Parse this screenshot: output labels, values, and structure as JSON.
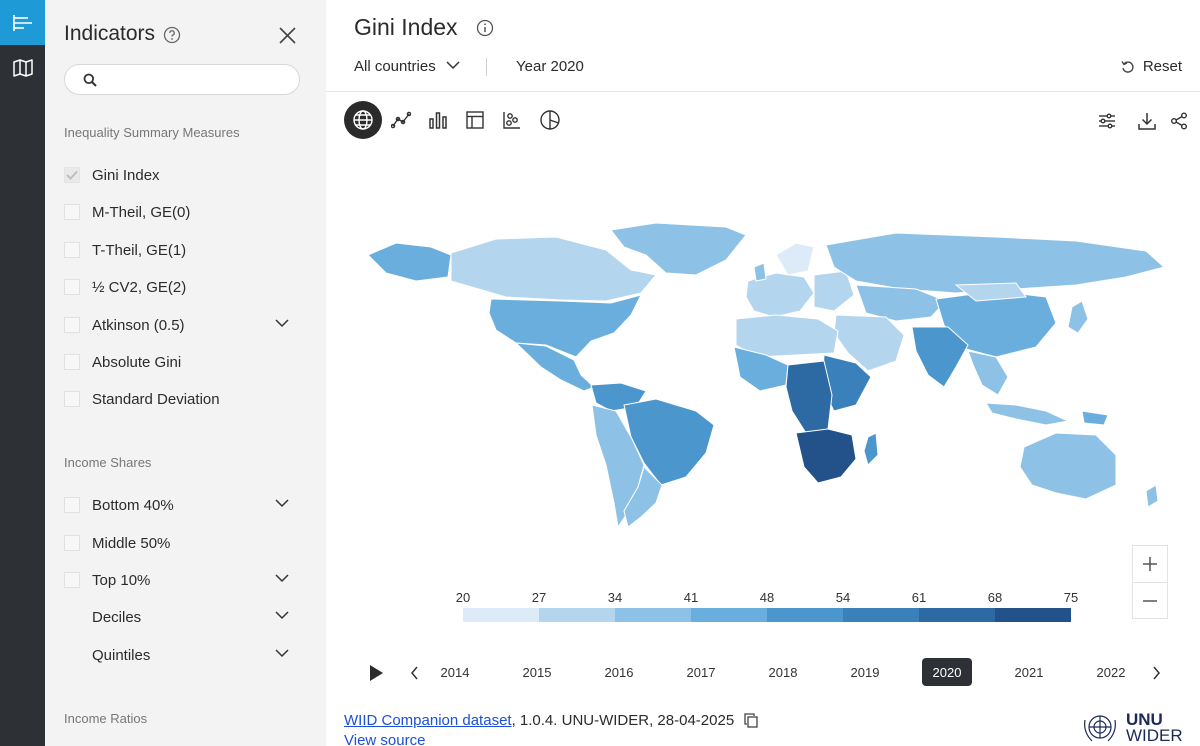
{
  "sidebar": {
    "title": "Indicators",
    "search": {
      "placeholder": "",
      "value": ""
    },
    "sections": [
      {
        "heading": "Inequality Summary Measures",
        "items": [
          {
            "label": "Gini Index",
            "checked": true,
            "expandable": false
          },
          {
            "label": "M-Theil, GE(0)",
            "checked": false,
            "expandable": false
          },
          {
            "label": "T-Theil, GE(1)",
            "checked": false,
            "expandable": false
          },
          {
            "label": "½ CV2, GE(2)",
            "checked": false,
            "expandable": false
          },
          {
            "label": "Atkinson (0.5)",
            "checked": false,
            "expandable": true
          },
          {
            "label": "Absolute Gini",
            "checked": false,
            "expandable": false
          },
          {
            "label": "Standard Deviation",
            "checked": false,
            "expandable": false
          }
        ]
      },
      {
        "heading": "Income Shares",
        "items": [
          {
            "label": "Bottom 40%",
            "checked": false,
            "expandable": true
          },
          {
            "label": "Middle 50%",
            "checked": false,
            "expandable": false
          },
          {
            "label": "Top 10%",
            "checked": false,
            "expandable": true
          },
          {
            "label": "Deciles",
            "checked": null,
            "expandable": true
          },
          {
            "label": "Quintiles",
            "checked": null,
            "expandable": true
          }
        ]
      },
      {
        "heading": "Income Ratios",
        "items": []
      }
    ]
  },
  "header": {
    "title": "Gini Index",
    "country_filter": "All countries",
    "year_filter": "Year 2020",
    "reset_label": "Reset"
  },
  "view_tabs": [
    "map-view",
    "line-chart",
    "bar-chart",
    "table-view",
    "scatter-chart",
    "pie-chart"
  ],
  "active_view": "map-view",
  "tools": [
    "settings-sliders",
    "download",
    "share"
  ],
  "legend": {
    "ticks": [
      "20",
      "27",
      "34",
      "41",
      "48",
      "54",
      "61",
      "68",
      "75"
    ],
    "colors": [
      "#dcebf7",
      "#b3d6ee",
      "#8dc2e6",
      "#6aaedd",
      "#4b96cc",
      "#3a80bb",
      "#2d69a3",
      "#235189",
      "#1a3e6e"
    ]
  },
  "timeline": {
    "years": [
      "2014",
      "2015",
      "2016",
      "2017",
      "2018",
      "2019",
      "2020",
      "2021",
      "2022"
    ],
    "selected": "2020"
  },
  "footer": {
    "dataset_link": "WIID Companion dataset",
    "dataset_info": ", 1.0.4. UNU-WIDER, 28-04-2025",
    "view_source": "View source"
  },
  "logo": {
    "line1": "UNU",
    "line2": "WIDER"
  }
}
